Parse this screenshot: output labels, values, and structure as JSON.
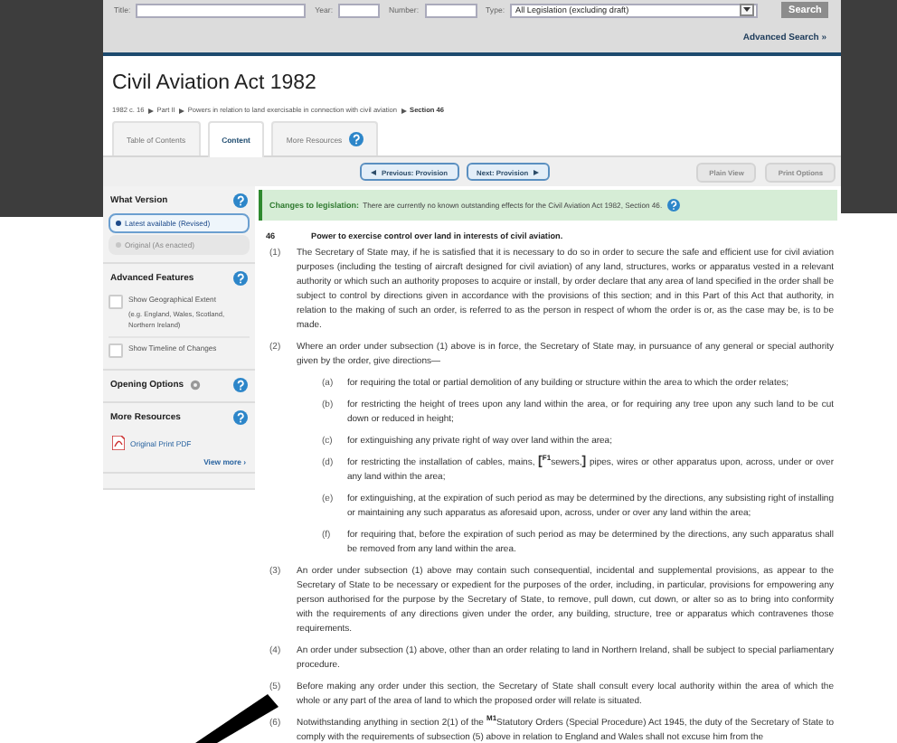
{
  "search_bar": {
    "fields": [
      {
        "label": "Title:"
      },
      {
        "label": "Year:"
      },
      {
        "label": "Number:"
      }
    ],
    "type": {
      "label": "Type:",
      "value": "All Legislation (excluding draft)"
    },
    "button": "Search",
    "advanced_link": "Advanced Search »"
  },
  "title": "Civil Aviation Act 1982",
  "breadcrumb": [
    {
      "label": "1982 c. 16",
      "current": false
    },
    {
      "label": "Part II",
      "current": false
    },
    {
      "label": "Powers in relation to land exercisable in connection with civil aviation",
      "current": false
    },
    {
      "label": "Section 46",
      "current": true
    }
  ],
  "tabs": [
    {
      "label": "Table of Contents",
      "selected": false,
      "help": false
    },
    {
      "label": "Content",
      "selected": true,
      "help": false
    },
    {
      "label": "More Resources",
      "selected": false,
      "help": true
    }
  ],
  "toolbar": {
    "nav": [
      {
        "label": "Previous: Provision",
        "kind": "previous"
      },
      {
        "label": "Next: Provision",
        "kind": "next"
      }
    ],
    "views": [
      "Plain View",
      "Print Options"
    ]
  },
  "sidebar": [
    {
      "kind": "version",
      "title": "What Version",
      "options": [
        {
          "label": "Latest available (Revised)",
          "selected": true
        },
        {
          "label": "Original (As enacted)",
          "selected": false
        }
      ]
    },
    {
      "kind": "features",
      "title": "Advanced Features",
      "options": [
        {
          "label": "Show Geographical Extent",
          "note": "(e.g. England, Wales, Scotland, Northern Ireland)",
          "checked": false
        },
        {
          "label": "Show Timeline of Changes",
          "checked": false
        }
      ]
    },
    {
      "kind": "options",
      "title": "Opening Options"
    },
    {
      "kind": "resources",
      "title": "More Resources",
      "links": [
        {
          "label": "Original Print PDF"
        }
      ],
      "more": "View more ›"
    }
  ],
  "changes_banner": {
    "label": "Changes to legislation:",
    "text": "There are currently no known outstanding effects for the Civil Aviation Act 1982, Section 46."
  },
  "section": {
    "number": "46",
    "heading": "Power to exercise control over land in interests of civil aviation.",
    "subsections": [
      {
        "number": "(1)",
        "text": "The Secretary of State may, if he is satisfied that it is necessary to do so in order to secure the safe and efficient use for civil aviation purposes (including the testing of aircraft designed for civil aviation) of any land, structures, works or apparatus vested in a relevant authority or which such an authority proposes to acquire or install, by order declare that any area of land specified in the order shall be subject to control by directions given in accordance with the provisions of this section; and in this Part of this Act that authority, in relation to the making of such an order, is referred to as the person in respect of whom the order is or, as the case may be, is to be made."
      },
      {
        "number": "(2)",
        "text": "Where an order under subsection (1) above is in force, the Secretary of State may, in pursuance of any general or special authority given by the order, give directions—",
        "paragraphs": [
          {
            "number": "(a)",
            "text": "for requiring the total or partial demolition of any building or structure within the area to which the order relates;"
          },
          {
            "number": "(b)",
            "text": "for restricting the height of trees upon any land within the area, or for requiring any tree upon any such land to be cut down or reduced in height;"
          },
          {
            "number": "(c)",
            "text": "for extinguishing any private right of way over land within the area;"
          },
          {
            "number": "(d)",
            "text": "for restricting the installation of cables, mains, **[**$^{F1}$sewers,**]** pipes, wires or other apparatus upon, across, under or over any land within the area;"
          },
          {
            "number": "(e)",
            "text": "for extinguishing, at the expiration of such period as may be determined by the directions, any subsisting right of installing or maintaining any such apparatus as aforesaid upon, across, under or over any land within the area;"
          },
          {
            "number": "(f)",
            "text": "for requiring that, before the expiration of such period as may be determined by the directions, any such apparatus shall be removed from any land within the area."
          }
        ]
      },
      {
        "number": "(3)",
        "text": "An order under subsection (1) above may contain such consequential, incidental and supplemental provisions, as appear to the Secretary of State to be necessary or expedient for the purposes of the order, including, in particular, provisions for empowering any person authorised for the purpose by the Secretary of State, to remove, pull down, cut down, or alter so as to bring into conformity with the requirements of any directions given under the order, any building, structure, tree or apparatus which contravenes those requirements."
      },
      {
        "number": "(4)",
        "text": "An order under subsection (1) above, other than an order relating to land in Northern Ireland, shall be subject to special parliamentary procedure."
      },
      {
        "number": "(5)",
        "text": "Before making any order under this section, the Secretary of State shall consult every local authority within the area of which the whole or any part of the area of land to which the proposed order will relate is situated."
      },
      {
        "number": "(6)",
        "text": "Notwithstanding anything in section 2(1) of the $^{M1}$Statutory Orders (Special Procedure) Act 1945, the duty of the Secretary of State to comply with the requirements of subsection (5) above in relation to England and Wales shall not excuse him from the"
      }
    ]
  }
}
